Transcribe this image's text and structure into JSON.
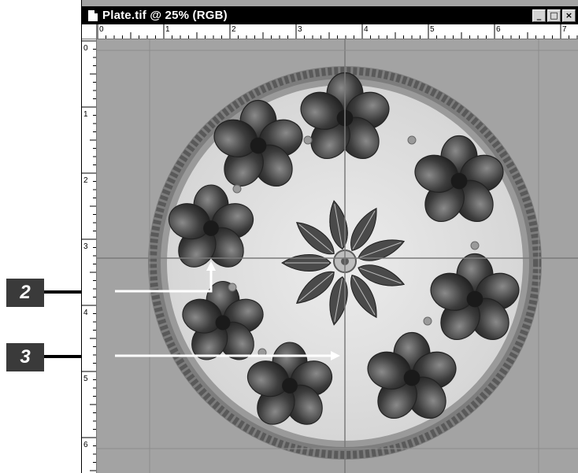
{
  "window": {
    "title": "Plate.tif @ 25% (RGB)",
    "buttons": {
      "minimize": "_",
      "restore": "□",
      "close": "×"
    }
  },
  "rulers": {
    "horizontal_labels": [
      "0",
      "1",
      "2",
      "3",
      "4",
      "5",
      "6",
      "7"
    ],
    "vertical_labels": [
      "0",
      "1",
      "2",
      "3",
      "4",
      "5",
      "6"
    ]
  },
  "callouts": [
    {
      "label": "2",
      "target": "guide-intersection-left"
    },
    {
      "label": "3",
      "target": "vertical-guide"
    }
  ],
  "icons": {
    "document": "document-icon",
    "minimize": "minimize-icon",
    "restore": "restore-icon",
    "close": "close-icon"
  },
  "colors": {
    "canvas_gray": "#a3a3a3",
    "guide": "#7a7a7a",
    "callout_badge": "#3a3a3a"
  }
}
